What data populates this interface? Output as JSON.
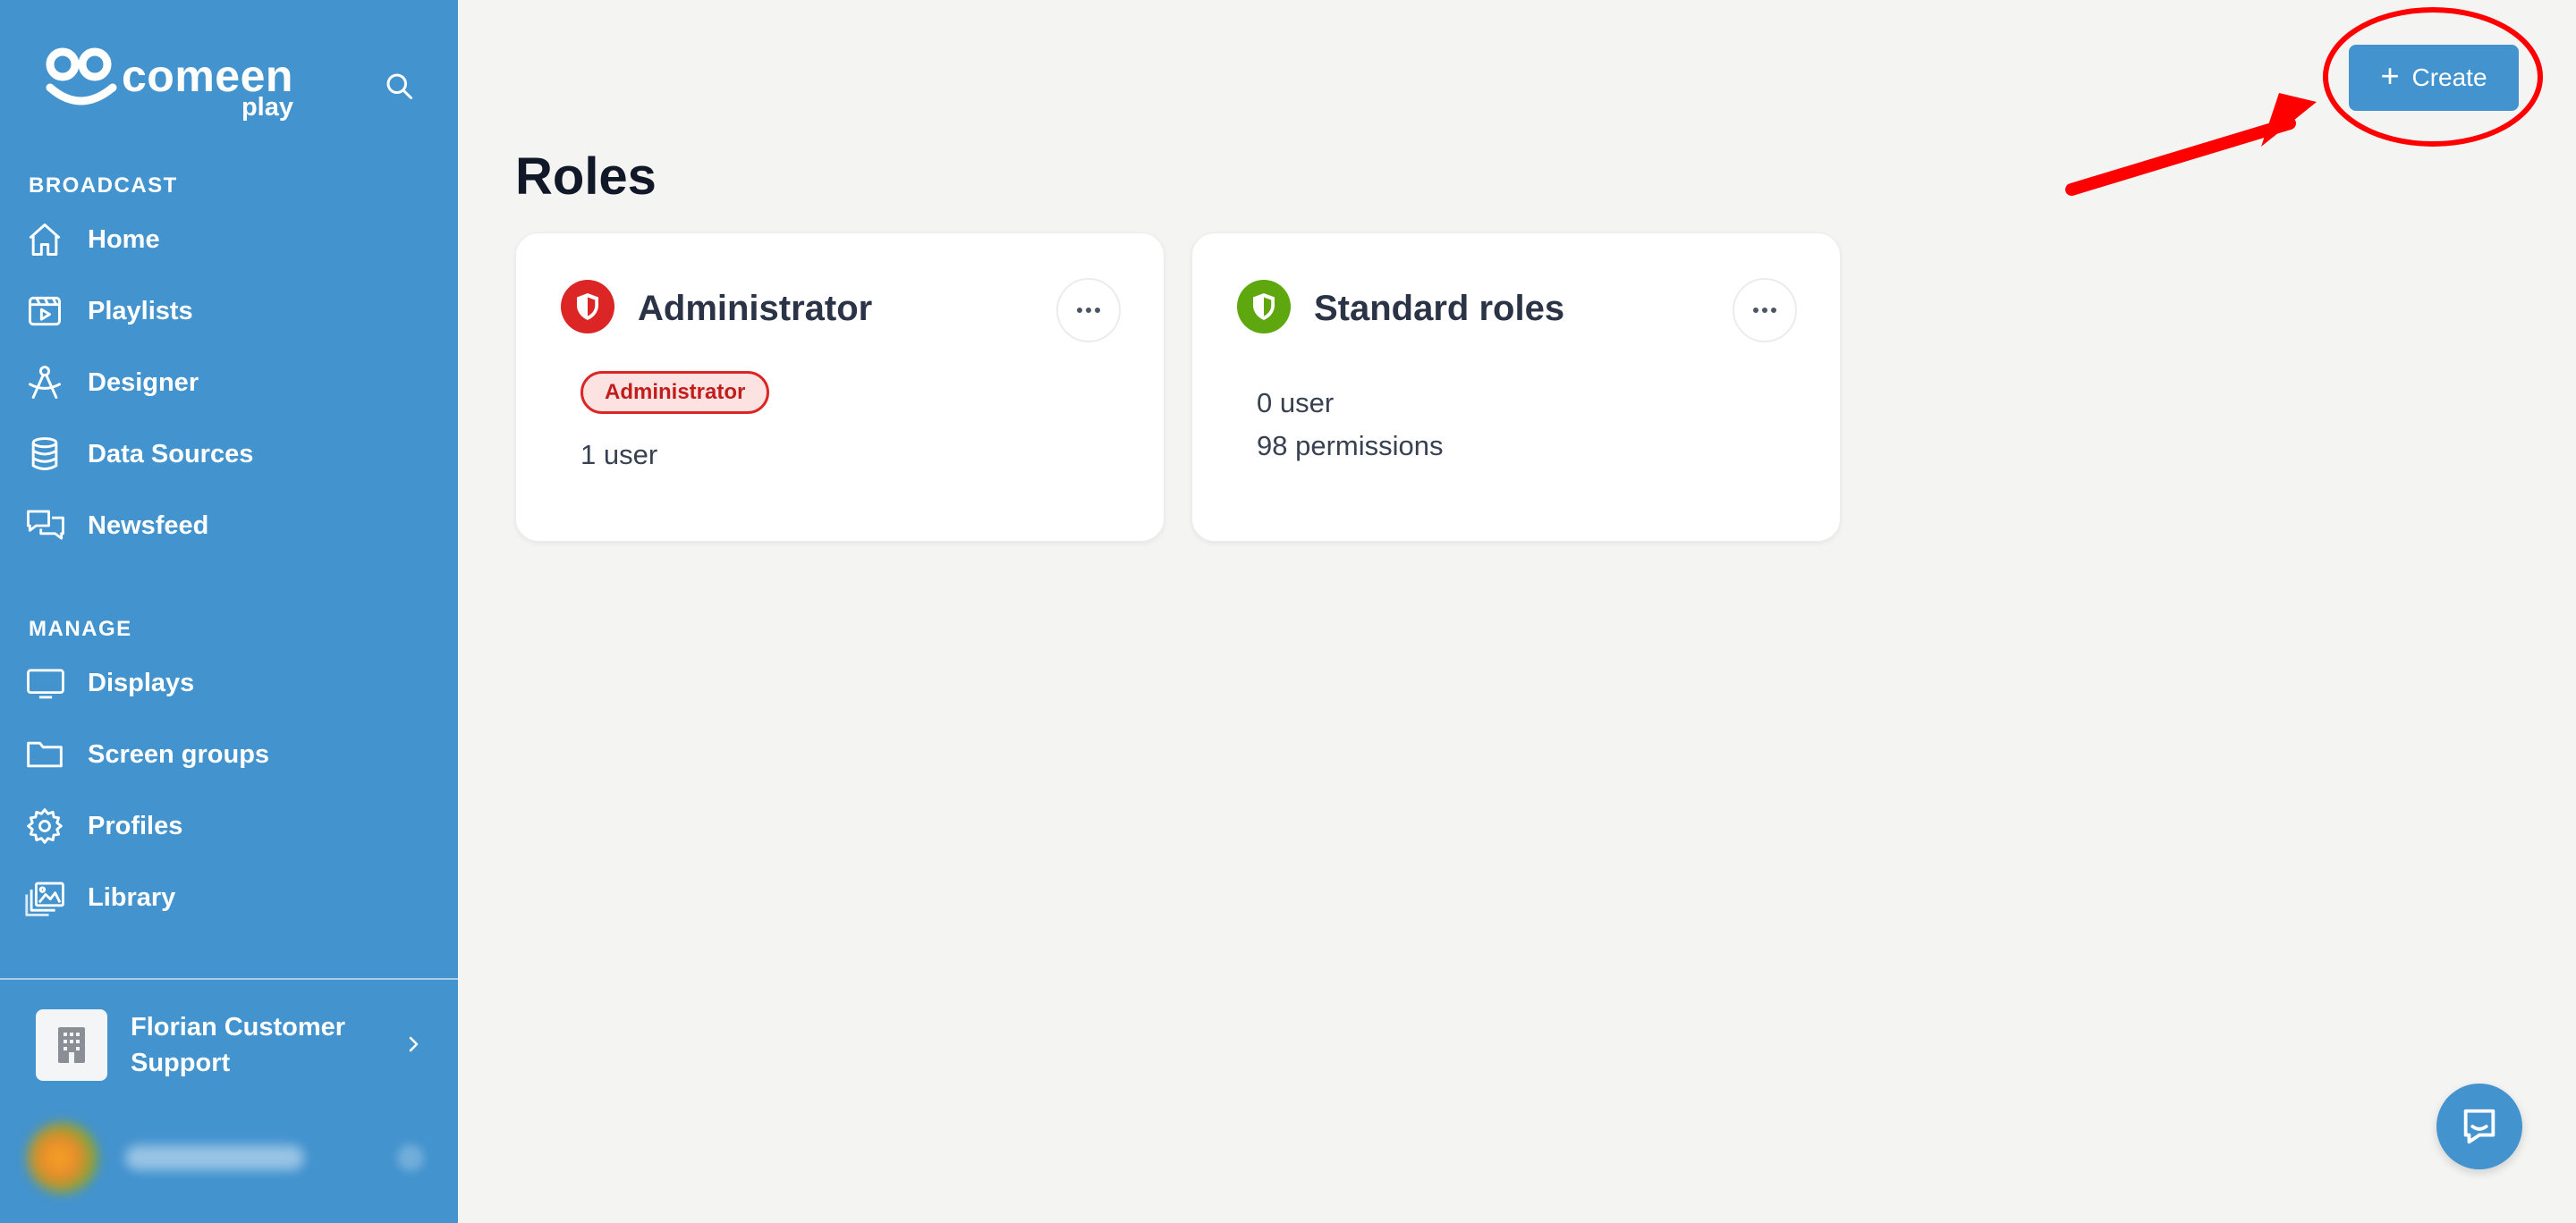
{
  "brand": {
    "name": "comeen",
    "sub": "play"
  },
  "colors": {
    "sidebar": "#4393cf",
    "accent": "#4393cf",
    "danger": "#dc2626",
    "success": "#5ea70f",
    "annotation": "#ff0000"
  },
  "sidebar": {
    "sections": [
      {
        "label": "BROADCAST",
        "items": [
          {
            "label": "Home",
            "icon": "home-icon"
          },
          {
            "label": "Playlists",
            "icon": "playlist-icon"
          },
          {
            "label": "Designer",
            "icon": "designer-icon"
          },
          {
            "label": "Data Sources",
            "icon": "database-icon"
          },
          {
            "label": "Newsfeed",
            "icon": "chat-bubbles-icon"
          }
        ]
      },
      {
        "label": "MANAGE",
        "items": [
          {
            "label": "Displays",
            "icon": "monitor-icon"
          },
          {
            "label": "Screen groups",
            "icon": "folder-icon"
          },
          {
            "label": "Profiles",
            "icon": "gear-icon"
          },
          {
            "label": "Library",
            "icon": "images-icon"
          }
        ]
      }
    ],
    "org": {
      "name": "Florian Customer Support"
    }
  },
  "main": {
    "title": "Roles",
    "create_label": "Create",
    "cards": [
      {
        "title": "Administrator",
        "badge": "Administrator",
        "lines": [
          "1 user"
        ]
      },
      {
        "title": "Standard roles",
        "lines": [
          "0 user",
          "98 permissions"
        ]
      }
    ]
  }
}
